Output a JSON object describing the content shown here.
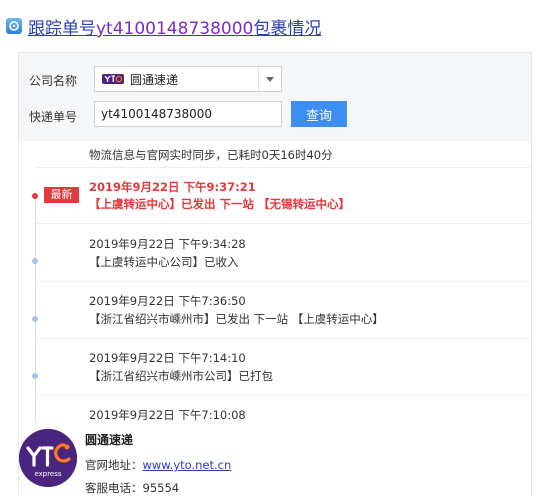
{
  "header": {
    "title_prefix": "跟踪单号",
    "tracking_number": "yt4100148738000",
    "title_suffix": "包裹情况"
  },
  "form": {
    "company_label": "公司名称",
    "company_value": "圆通速递",
    "tracking_label": "快递单号",
    "tracking_value": "yt4100148738000",
    "query_label": "查询"
  },
  "sync_note": "物流信息与官网实时同步，已耗时0天16时40分",
  "latest_badge": "最新",
  "entries": [
    {
      "time": "2019年9月22日 下午9:37:21",
      "desc": "【上虞转运中心】已发出 下一站 【无锡转运中心】"
    },
    {
      "time": "2019年9月22日 下午9:34:28",
      "desc": "【上虞转运中心公司】已收入"
    },
    {
      "time": "2019年9月22日 下午7:36:50",
      "desc": "【浙江省绍兴市嵊州市】已发出 下一站 【上虞转运中心】"
    },
    {
      "time": "2019年9月22日 下午7:14:10",
      "desc": "【浙江省绍兴市嵊州市公司】已打包"
    },
    {
      "time": "2019年9月22日 下午7:10:08",
      "desc": ""
    }
  ],
  "company": {
    "name": "圆通速递",
    "website_label": "官网地址：",
    "website": "www.yto.net.cn",
    "phone_label": "客服电话：",
    "phone": "95554",
    "logo_text": "express"
  },
  "colors": {
    "accent": "#3d8ef0",
    "latest": "#e4393c",
    "brand": "#4a2580"
  }
}
